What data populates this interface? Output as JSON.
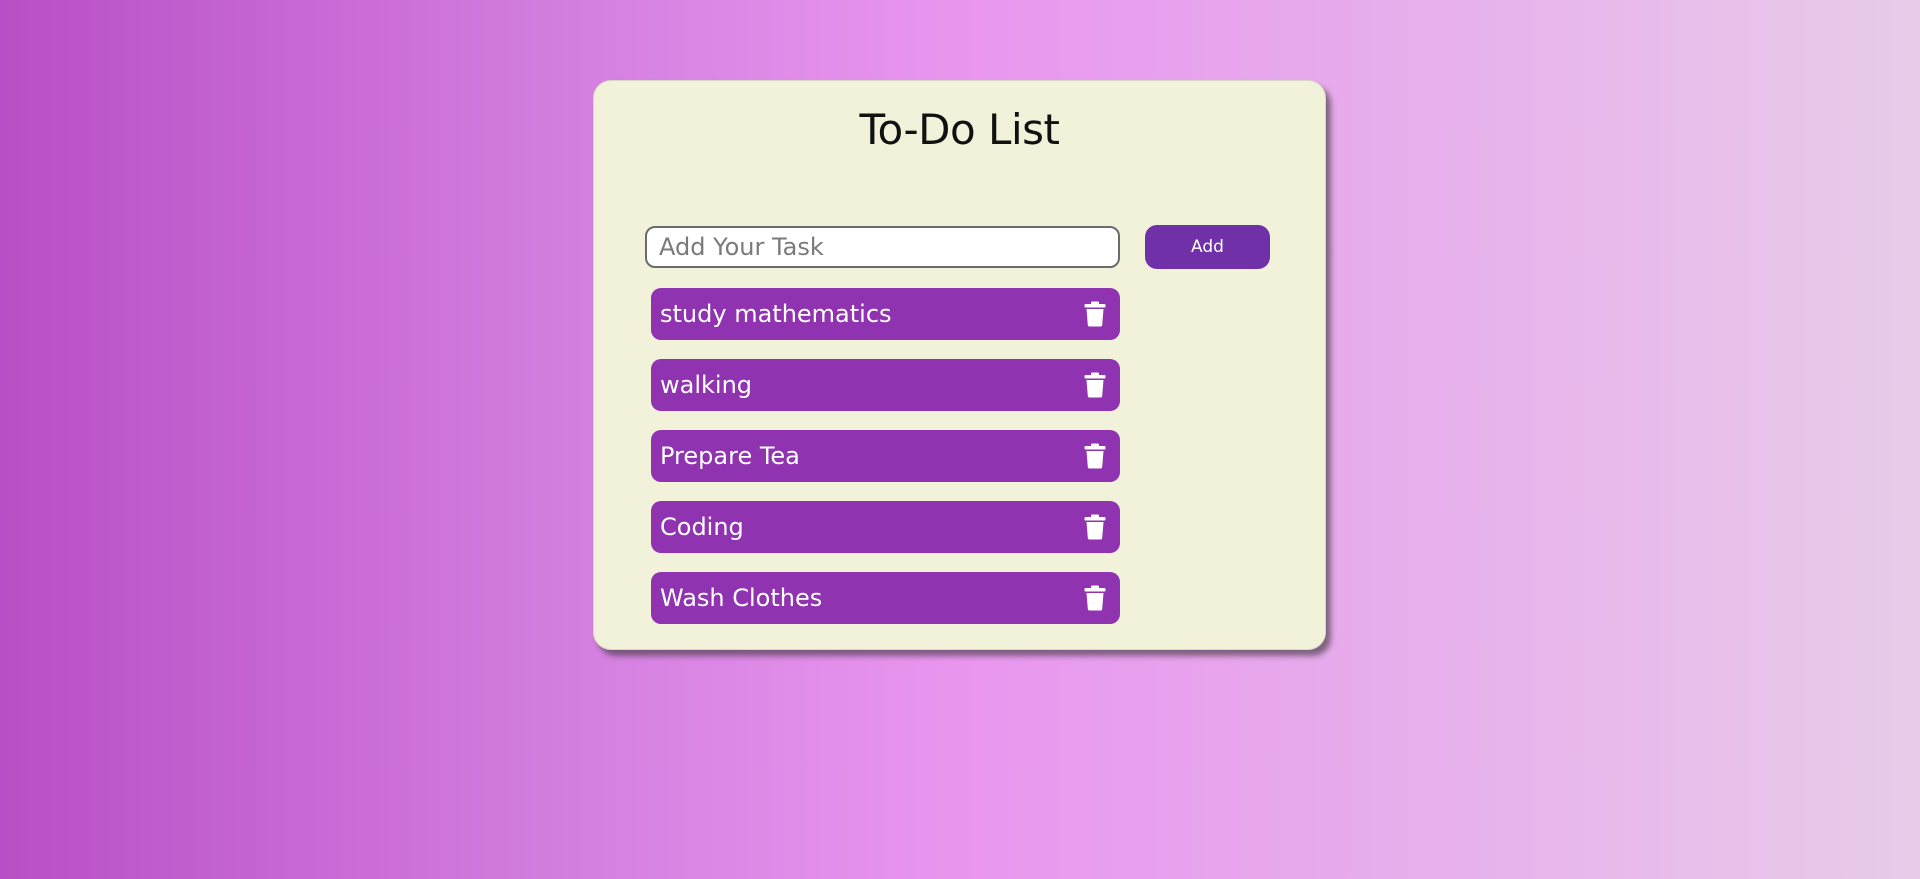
{
  "app": {
    "title": "To-Do List"
  },
  "input": {
    "value": "",
    "placeholder": "Add Your Task"
  },
  "add_button": {
    "label": "Add"
  },
  "tasks": [
    {
      "label": "study mathematics",
      "icon": "trash-icon"
    },
    {
      "label": "walking",
      "icon": "trash-icon"
    },
    {
      "label": "Prepare Tea",
      "icon": "trash-icon"
    },
    {
      "label": "Coding",
      "icon": "trash-icon"
    },
    {
      "label": "Wash Clothes",
      "icon": "trash-icon"
    }
  ],
  "colors": {
    "card_background": "#f2f2da",
    "task_background": "#9033b1",
    "button_background": "#7030a8",
    "gradient_left": "#b84fc6",
    "gradient_mid": "#e996ef",
    "gradient_right": "#e8cbe9"
  }
}
